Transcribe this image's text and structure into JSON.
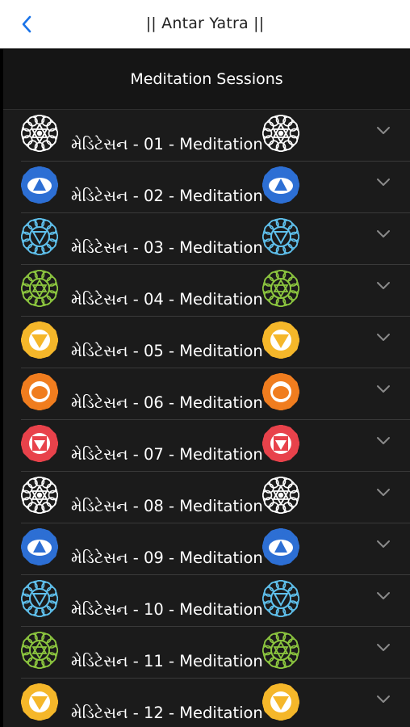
{
  "topbar": {
    "title": "|| Antar Yatra ||",
    "back_icon": "chevron-left-icon",
    "accent": "#1a73e8"
  },
  "section": {
    "title": "Meditation Sessions"
  },
  "sessions": [
    {
      "label": "મેડિટેસન - 01 - Meditation",
      "icon": "chakra-crown-icon",
      "color": "#ffffff",
      "variant": "crown"
    },
    {
      "label": "મેડિટેસન - 02 - Meditation",
      "icon": "chakra-third-eye-icon",
      "color": "#2d6fd4",
      "variant": "thirdeye"
    },
    {
      "label": "મેડિટેસન - 03 - Meditation",
      "icon": "chakra-throat-icon",
      "color": "#5fc0ec",
      "variant": "throat"
    },
    {
      "label": "મેડિટેસન - 04 - Meditation",
      "icon": "chakra-heart-icon",
      "color": "#8cc63f",
      "variant": "heart"
    },
    {
      "label": "મેડિટેસન - 05 - Meditation",
      "icon": "chakra-solar-plexus-icon",
      "color": "#f5b72a",
      "variant": "solar"
    },
    {
      "label": "મેડિટેસન - 06 - Meditation",
      "icon": "chakra-sacral-icon",
      "color": "#f07d1f",
      "variant": "sacral"
    },
    {
      "label": "મેડિટેસન - 07 - Meditation",
      "icon": "chakra-root-icon",
      "color": "#e8424b",
      "variant": "root"
    },
    {
      "label": "મેડિટેસન - 08 - Meditation",
      "icon": "chakra-crown-icon",
      "color": "#ffffff",
      "variant": "crown"
    },
    {
      "label": "મેડિટેસન - 09 - Meditation",
      "icon": "chakra-third-eye-icon",
      "color": "#2d6fd4",
      "variant": "thirdeye"
    },
    {
      "label": "મેડિટેસન - 10 - Meditation",
      "icon": "chakra-throat-icon",
      "color": "#5fc0ec",
      "variant": "throat"
    },
    {
      "label": "મેડિટેસન - 11 - Meditation",
      "icon": "chakra-heart-icon",
      "color": "#8cc63f",
      "variant": "heart"
    },
    {
      "label": "મેડિટેસન - 12 - Meditation",
      "icon": "chakra-solar-plexus-icon",
      "color": "#f5b72a",
      "variant": "solar"
    }
  ],
  "row_chevron_icon": "chevron-down-icon"
}
